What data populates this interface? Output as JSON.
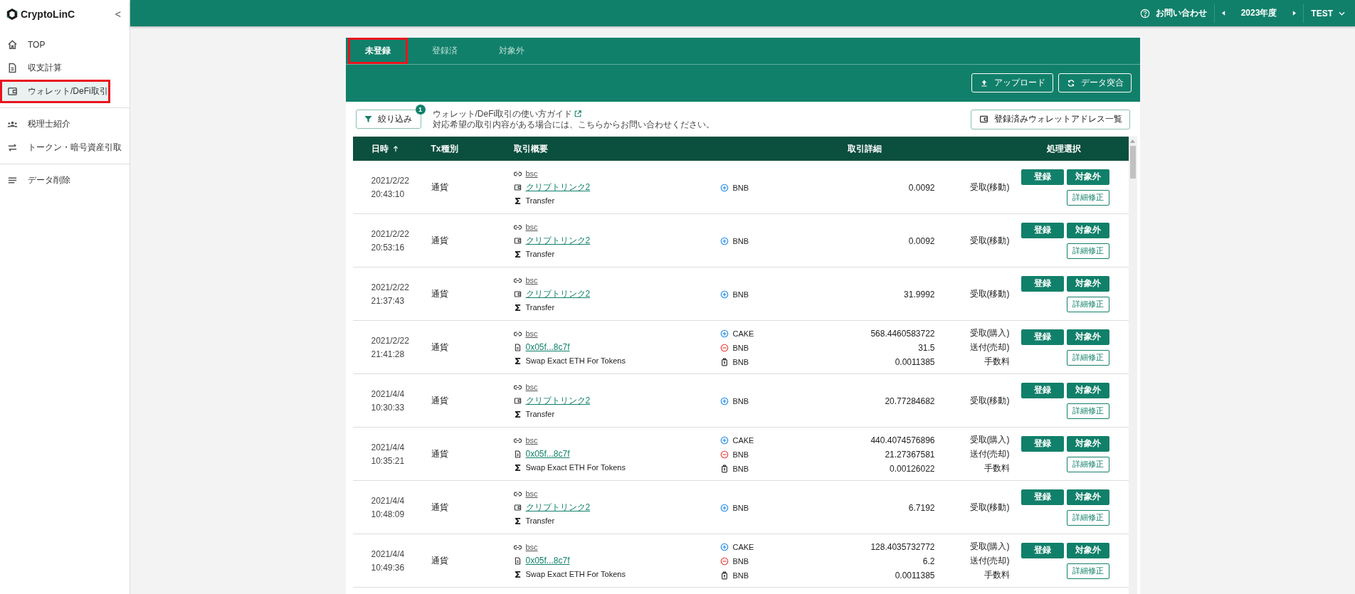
{
  "sidebar": {
    "logo": "CryptoLinC",
    "collapse": "<",
    "groups": [
      [
        {
          "kind": "home",
          "label": "TOP",
          "selected": false,
          "highlighted": false
        },
        {
          "kind": "document",
          "label": "収支計算",
          "selected": false,
          "highlighted": false
        },
        {
          "kind": "wallet",
          "label": "ウォレット/DeFi取引",
          "selected": true,
          "highlighted": true
        }
      ],
      [
        {
          "kind": "people",
          "label": "税理士紹介",
          "selected": false,
          "highlighted": false
        },
        {
          "kind": "transfer",
          "label": "トークン・暗号資産引取",
          "selected": false,
          "highlighted": false
        }
      ],
      [
        {
          "kind": "list",
          "label": "データ削除",
          "selected": false,
          "highlighted": false
        }
      ]
    ]
  },
  "header": {
    "contact": "お問い合わせ",
    "year": "2023年度",
    "user": "TEST"
  },
  "tabs": [
    {
      "label": "未登録",
      "selected": true,
      "highlighted": true
    },
    {
      "label": "登録済",
      "selected": false,
      "highlighted": false
    },
    {
      "label": "対象外",
      "selected": false,
      "highlighted": false
    }
  ],
  "toolbar": {
    "buttons": [
      {
        "kind": "upload",
        "label": "アップロード"
      },
      {
        "kind": "sync",
        "label": "データ突合"
      }
    ]
  },
  "filter": {
    "label": "絞り込み",
    "badge": "1",
    "guide_link": "ウォレット/DeFi取引の使い方ガイド",
    "note": "対応希望の取引内容がある場合には、こちらからお問い合わせください。",
    "address_list": "登録済みウォレットアドレス一覧"
  },
  "table": {
    "columns": [
      "日時",
      "Tx種別",
      "取引概要",
      "取引詳細",
      "処理選択"
    ],
    "rows": [
      {
        "date": "2021/2/22",
        "time": "20:43:10",
        "tx_type": "通貨",
        "chain": "bsc",
        "source": {
          "kind": "wallet",
          "text": "クリプトリンク2"
        },
        "method": "Transfer",
        "details": [
          {
            "kind": "in",
            "token": "BNB",
            "amount": "0.0092",
            "type": "受取(移動)"
          }
        ],
        "actions": [
          "登録",
          "対象外",
          "詳細修正"
        ]
      },
      {
        "date": "2021/2/22",
        "time": "20:53:16",
        "tx_type": "通貨",
        "chain": "bsc",
        "source": {
          "kind": "wallet",
          "text": "クリプトリンク2"
        },
        "method": "Transfer",
        "details": [
          {
            "kind": "in",
            "token": "BNB",
            "amount": "0.0092",
            "type": "受取(移動)"
          }
        ],
        "actions": [
          "登録",
          "対象外",
          "詳細修正"
        ]
      },
      {
        "date": "2021/2/22",
        "time": "21:37:43",
        "tx_type": "通貨",
        "chain": "bsc",
        "source": {
          "kind": "wallet",
          "text": "クリプトリンク2"
        },
        "method": "Transfer",
        "details": [
          {
            "kind": "in",
            "token": "BNB",
            "amount": "31.9992",
            "type": "受取(移動)"
          }
        ],
        "actions": [
          "登録",
          "対象外",
          "詳細修正"
        ]
      },
      {
        "date": "2021/2/22",
        "time": "21:41:28",
        "tx_type": "通貨",
        "chain": "bsc",
        "source": {
          "kind": "contract",
          "text": "0x05f...8c7f"
        },
        "method": "Swap Exact ETH For Tokens",
        "details": [
          {
            "kind": "in",
            "token": "CAKE",
            "amount": "568.4460583722",
            "type": "受取(購入)"
          },
          {
            "kind": "out",
            "token": "BNB",
            "amount": "31.5",
            "type": "送付(売却)"
          },
          {
            "kind": "fee",
            "token": "BNB",
            "amount": "0.0011385",
            "type": "手数料"
          }
        ],
        "actions": [
          "登録",
          "対象外",
          "詳細修正"
        ]
      },
      {
        "date": "2021/4/4",
        "time": "10:30:33",
        "tx_type": "通貨",
        "chain": "bsc",
        "source": {
          "kind": "wallet",
          "text": "クリプトリンク2"
        },
        "method": "Transfer",
        "details": [
          {
            "kind": "in",
            "token": "BNB",
            "amount": "20.77284682",
            "type": "受取(移動)"
          }
        ],
        "actions": [
          "登録",
          "対象外",
          "詳細修正"
        ]
      },
      {
        "date": "2021/4/4",
        "time": "10:35:21",
        "tx_type": "通貨",
        "chain": "bsc",
        "source": {
          "kind": "contract",
          "text": "0x05f...8c7f"
        },
        "method": "Swap Exact ETH For Tokens",
        "details": [
          {
            "kind": "in",
            "token": "CAKE",
            "amount": "440.4074576896",
            "type": "受取(購入)"
          },
          {
            "kind": "out",
            "token": "BNB",
            "amount": "21.27367581",
            "type": "送付(売却)"
          },
          {
            "kind": "fee",
            "token": "BNB",
            "amount": "0.00126022",
            "type": "手数料"
          }
        ],
        "actions": [
          "登録",
          "対象外",
          "詳細修正"
        ]
      },
      {
        "date": "2021/4/4",
        "time": "10:48:09",
        "tx_type": "通貨",
        "chain": "bsc",
        "source": {
          "kind": "wallet",
          "text": "クリプトリンク2"
        },
        "method": "Transfer",
        "details": [
          {
            "kind": "in",
            "token": "BNB",
            "amount": "6.7192",
            "type": "受取(移動)"
          }
        ],
        "actions": [
          "登録",
          "対象外",
          "詳細修正"
        ]
      },
      {
        "date": "2021/4/4",
        "time": "10:49:36",
        "tx_type": "通貨",
        "chain": "bsc",
        "source": {
          "kind": "contract",
          "text": "0x05f...8c7f"
        },
        "method": "Swap Exact ETH For Tokens",
        "details": [
          {
            "kind": "in",
            "token": "CAKE",
            "amount": "128.4035732772",
            "type": "受取(購入)"
          },
          {
            "kind": "out",
            "token": "BNB",
            "amount": "6.2",
            "type": "送付(売却)"
          },
          {
            "kind": "fee",
            "token": "BNB",
            "amount": "0.0011385",
            "type": "手数料"
          }
        ],
        "actions": [
          "登録",
          "対象外",
          "詳細修正"
        ]
      }
    ]
  }
}
